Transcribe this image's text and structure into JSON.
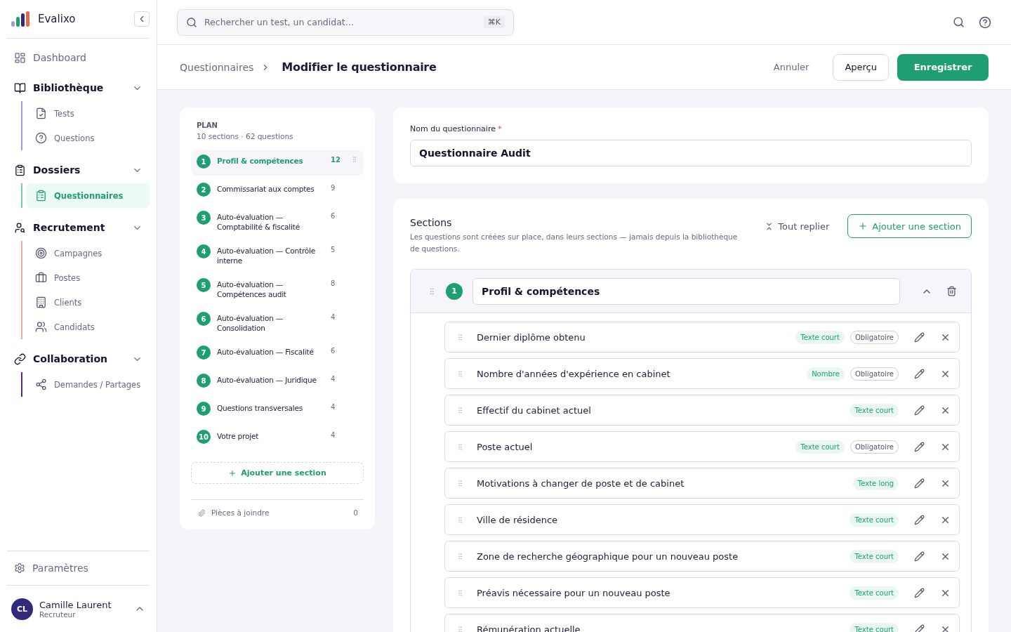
{
  "brand": {
    "name": "Evalixo"
  },
  "nav": [
    {
      "kind": "item",
      "label": "Dashboard",
      "selected": false
    },
    {
      "kind": "group",
      "label": "Bibliothèque",
      "expanded": true,
      "color": "#a09cdc",
      "children": [
        {
          "label": "Tests",
          "selected": false
        },
        {
          "label": "Questions",
          "selected": false
        }
      ]
    },
    {
      "kind": "group",
      "label": "Dossiers",
      "expanded": true,
      "color": "#7cc9a8",
      "children": [
        {
          "label": "Questionnaires",
          "selected": true
        }
      ]
    },
    {
      "kind": "group",
      "label": "Recrutement",
      "expanded": true,
      "color": "#f0aa9c",
      "children": [
        {
          "label": "Campagnes",
          "selected": false
        },
        {
          "label": "Postes",
          "selected": false
        },
        {
          "label": "Clients",
          "selected": false
        },
        {
          "label": "Candidats",
          "selected": false
        }
      ]
    },
    {
      "kind": "group",
      "label": "Collaboration",
      "expanded": true,
      "color": "#5b2a6e",
      "children": [
        {
          "label": "Demandes / Partages",
          "selected": false
        }
      ]
    }
  ],
  "settings": {
    "label": "Paramètres"
  },
  "user": {
    "initials": "CL",
    "name": "Camille Laurent",
    "role": "Recruteur"
  },
  "search": {
    "placeholder": "Rechercher un test, un candidat…",
    "shortcut": "⌘K"
  },
  "breadcrumb": {
    "parent": "Questionnaires",
    "current": "Modifier le questionnaire"
  },
  "actions": {
    "cancel": "Annuler",
    "preview": "Aperçu",
    "save": "Enregistrer"
  },
  "plan": {
    "title": "PLAN",
    "summary": "10 sections · 62 questions",
    "add": "Ajouter une section",
    "attachments": {
      "label": "Pièces à joindre",
      "count": "0"
    },
    "sections": [
      {
        "number": "1",
        "title": "Profil & compétences",
        "count": "12",
        "selected": true
      },
      {
        "number": "2",
        "title": "Commissariat aux comptes",
        "count": "9",
        "selected": false
      },
      {
        "number": "3",
        "title": "Auto-évaluation — Comptabilité & fiscalité",
        "count": "6",
        "selected": false
      },
      {
        "number": "4",
        "title": "Auto-évaluation — Contrôle interne",
        "count": "5",
        "selected": false
      },
      {
        "number": "5",
        "title": "Auto-évaluation — Compétences audit",
        "count": "8",
        "selected": false
      },
      {
        "number": "6",
        "title": "Auto-évaluation — Consolidation",
        "count": "4",
        "selected": false
      },
      {
        "number": "7",
        "title": "Auto-évaluation — Fiscalité",
        "count": "6",
        "selected": false
      },
      {
        "number": "8",
        "title": "Auto-évaluation — Juridique",
        "count": "4",
        "selected": false
      },
      {
        "number": "9",
        "title": "Questions transversales",
        "count": "4",
        "selected": false
      },
      {
        "number": "10",
        "title": "Votre projet",
        "count": "4",
        "selected": false
      }
    ]
  },
  "name_field": {
    "label": "Nom du questionnaire",
    "required_mark": "*",
    "value": "Questionnaire Audit"
  },
  "sections_panel": {
    "title": "Sections",
    "description": "Les questions sont créées sur place, dans leurs sections — jamais depuis la bibliothèque de questions.",
    "collapse_all": "Tout replier",
    "add": "Ajouter une section",
    "open_section": {
      "number": "1",
      "title": "Profil & compétences",
      "expanded": true,
      "questions": [
        {
          "title": "Dernier diplôme obtenu",
          "tags": [
            {
              "kind": "type",
              "label": "Texte court"
            },
            {
              "kind": "required",
              "label": "Obligatoire"
            }
          ]
        },
        {
          "title": "Nombre d'années d'expérience en cabinet",
          "tags": [
            {
              "kind": "type",
              "label": "Nombre"
            },
            {
              "kind": "required",
              "label": "Obligatoire"
            }
          ]
        },
        {
          "title": "Effectif du cabinet actuel",
          "tags": [
            {
              "kind": "type",
              "label": "Texte court"
            }
          ]
        },
        {
          "title": "Poste actuel",
          "tags": [
            {
              "kind": "type",
              "label": "Texte court"
            },
            {
              "kind": "required",
              "label": "Obligatoire"
            }
          ]
        },
        {
          "title": "Motivations à changer de poste et de cabinet",
          "tags": [
            {
              "kind": "type",
              "label": "Texte long"
            }
          ]
        },
        {
          "title": "Ville de résidence",
          "tags": [
            {
              "kind": "type",
              "label": "Texte court"
            }
          ]
        },
        {
          "title": "Zone de recherche géographique pour un nouveau poste",
          "tags": [
            {
              "kind": "type",
              "label": "Texte court"
            }
          ]
        },
        {
          "title": "Préavis nécessaire pour un nouveau poste",
          "tags": [
            {
              "kind": "type",
              "label": "Texte court"
            }
          ]
        },
        {
          "title": "Rémunération actuelle",
          "tags": [
            {
              "kind": "type",
              "label": "Texte court"
            }
          ]
        }
      ]
    }
  }
}
